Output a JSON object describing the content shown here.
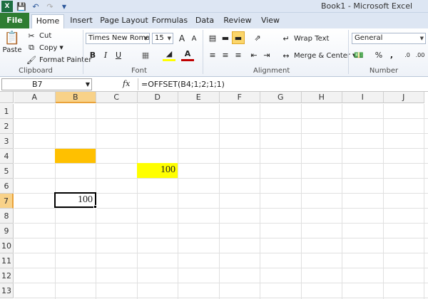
{
  "window": {
    "title": "Book1 - Microsoft Excel"
  },
  "qat": {
    "icons": [
      "excel-logo-icon",
      "save-icon",
      "undo-icon",
      "redo-icon",
      "customize-icon"
    ]
  },
  "tabs": [
    {
      "label": "File"
    },
    {
      "label": "Home"
    },
    {
      "label": "Insert"
    },
    {
      "label": "Page Layout"
    },
    {
      "label": "Formulas"
    },
    {
      "label": "Data"
    },
    {
      "label": "Review"
    },
    {
      "label": "View"
    }
  ],
  "ribbon": {
    "clipboard": {
      "label": "Clipboard",
      "paste": "Paste",
      "cut": "Cut",
      "copy": "Copy",
      "format_painter": "Format Painter"
    },
    "font": {
      "label": "Font",
      "name": "Times New Roman",
      "size": "15",
      "bold": "B",
      "italic": "I",
      "underline": "U",
      "grow": "A",
      "shrink": "A"
    },
    "alignment": {
      "label": "Alignment",
      "wrap": "Wrap Text",
      "merge": "Merge & Center"
    },
    "number": {
      "label": "Number",
      "format": "General",
      "percent": "%",
      "comma": ",",
      "inc": ".0",
      "dec": ".00"
    }
  },
  "formula_bar": {
    "name_box": "B7",
    "fx": "fx",
    "formula": "=OFFSET(B4;1;2;1;1)"
  },
  "sheet": {
    "columns": [
      "A",
      "B",
      "C",
      "D",
      "E",
      "F",
      "G",
      "H",
      "I",
      "J"
    ],
    "rows": [
      "1",
      "2",
      "3",
      "4",
      "5",
      "6",
      "7",
      "8",
      "9",
      "10",
      "11",
      "12",
      "13"
    ],
    "selected_col": "B",
    "selected_row": "7",
    "cells": {
      "D5": "100",
      "B7": "100"
    },
    "colors": {
      "B4": "#ffc000",
      "D5": "#ffff00"
    }
  }
}
